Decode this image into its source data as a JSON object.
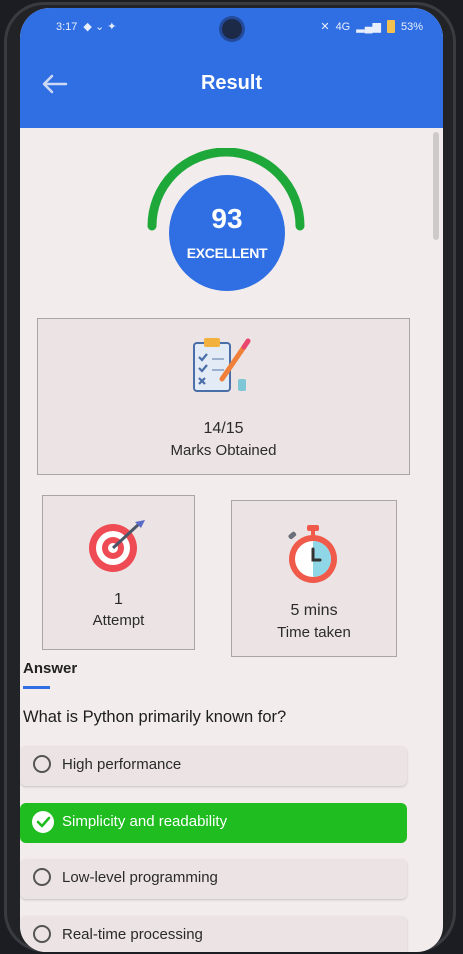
{
  "status": {
    "time": "3:17",
    "network": "4G",
    "battery": "53%"
  },
  "header": {
    "title": "Result"
  },
  "score": {
    "value": "93",
    "label": "EXCELLENT"
  },
  "marks": {
    "value": "14/15",
    "label": "Marks Obtained"
  },
  "attempt": {
    "value": "1",
    "label": "Attempt"
  },
  "time_taken": {
    "value": "5 mins",
    "label": "Time taken"
  },
  "answer": {
    "tab_label": "Answer",
    "question": "What is Python primarily known for?",
    "options": [
      {
        "label": "High performance",
        "selected": false
      },
      {
        "label": "Simplicity and readability",
        "selected": true
      },
      {
        "label": "Low-level programming",
        "selected": false
      },
      {
        "label": "Real-time processing",
        "selected": false
      }
    ]
  },
  "colors": {
    "primary": "#2f6fe3",
    "correct": "#1fbd1f",
    "gauge": "#1fa83a",
    "target": "#ef4b54"
  }
}
